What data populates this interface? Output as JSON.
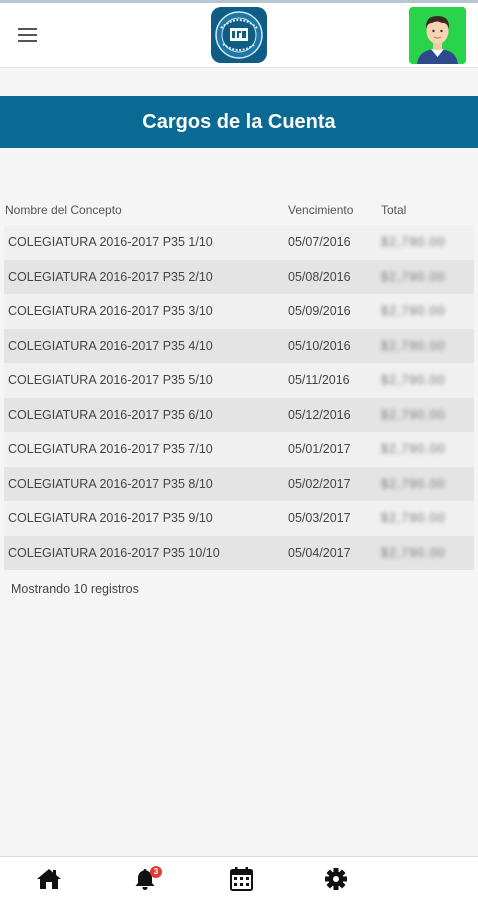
{
  "header": {
    "menu_icon": "hamburger-menu-icon",
    "logo_icon": "school-crest-logo",
    "avatar_icon": "user-avatar"
  },
  "banner": {
    "title": "Cargos de la Cuenta"
  },
  "table": {
    "columns": [
      "Nombre del Concepto",
      "Vencimiento",
      "Total"
    ],
    "rows": [
      {
        "concept": "COLEGIATURA 2016-2017 P35 1/10",
        "due": "05/07/2016",
        "total": "$2,790.00"
      },
      {
        "concept": "COLEGIATURA 2016-2017 P35 2/10",
        "due": "05/08/2016",
        "total": "$2,790.00"
      },
      {
        "concept": "COLEGIATURA 2016-2017 P35 3/10",
        "due": "05/09/2016",
        "total": "$2,790.00"
      },
      {
        "concept": "COLEGIATURA 2016-2017 P35 4/10",
        "due": "05/10/2016",
        "total": "$2,790.00"
      },
      {
        "concept": "COLEGIATURA 2016-2017 P35 5/10",
        "due": "05/11/2016",
        "total": "$2,790.00"
      },
      {
        "concept": "COLEGIATURA 2016-2017 P35 6/10",
        "due": "05/12/2016",
        "total": "$2,790.00"
      },
      {
        "concept": "COLEGIATURA 2016-2017 P35 7/10",
        "due": "05/01/2017",
        "total": "$2,790.00"
      },
      {
        "concept": "COLEGIATURA 2016-2017 P35 8/10",
        "due": "05/02/2017",
        "total": "$2,790.00"
      },
      {
        "concept": "COLEGIATURA 2016-2017 P35 9/10",
        "due": "05/03/2017",
        "total": "$2,790.00"
      },
      {
        "concept": "COLEGIATURA 2016-2017 P35 10/10",
        "due": "05/04/2017",
        "total": "$2,790.00"
      }
    ],
    "summary": "Mostrando 10 registros"
  },
  "bottom_nav": {
    "items": [
      {
        "icon": "home-icon"
      },
      {
        "icon": "bell-icon",
        "badge": "3"
      },
      {
        "icon": "calendar-icon"
      },
      {
        "icon": "gear-icon"
      }
    ]
  },
  "colors": {
    "banner": "#0a6a93",
    "avatar_bg": "#29d34a",
    "badge": "#e53935"
  }
}
